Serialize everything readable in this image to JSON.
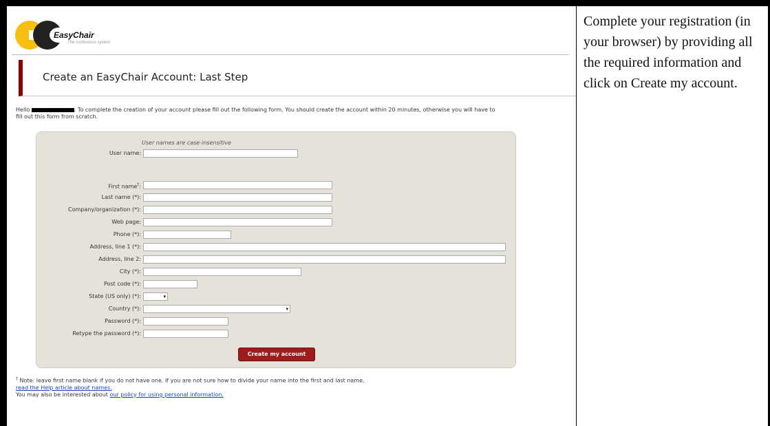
{
  "logo": {
    "name": "EasyChair",
    "tagline": "The conference system"
  },
  "page": {
    "title": "Create an EasyChair Account: Last Step"
  },
  "intro": {
    "prefix": "Hello ",
    "text": ". To complete the creation of your account please fill out the following form. You should create the account within 20 minutes, otherwise you will have to fill out this form from scratch."
  },
  "form": {
    "username_hint": "User names are case-insensitive",
    "fields": {
      "user_name": "User name:",
      "first_name": "First name",
      "first_name_suffix": ":",
      "last_name": "Last name (*):",
      "company": "Company/organization (*):",
      "web_page": "Web page:",
      "phone": "Phone (*):",
      "address1": "Address, line 1 (*):",
      "address2": "Address, line 2:",
      "city": "City (*):",
      "post_code": "Post code (*):",
      "state": "State (US only) (*):",
      "country": "Country (*):",
      "password": "Password (*):",
      "retype_password": "Retype the password (*):"
    },
    "dagger": "†",
    "submit_label": "Create my account"
  },
  "notes": {
    "dagger": "†",
    "line1": " Note: leave first name blank if you do not have one. If you are not sure how to divide your name into the first and last name,",
    "help_link": "read the Help article about names.",
    "line3_prefix": "You may also be interested about ",
    "policy_link": "our policy for using personal information."
  },
  "sidebar": {
    "text": "Complete your registration (in your browser) by providing all the required information and click on Create my account."
  }
}
